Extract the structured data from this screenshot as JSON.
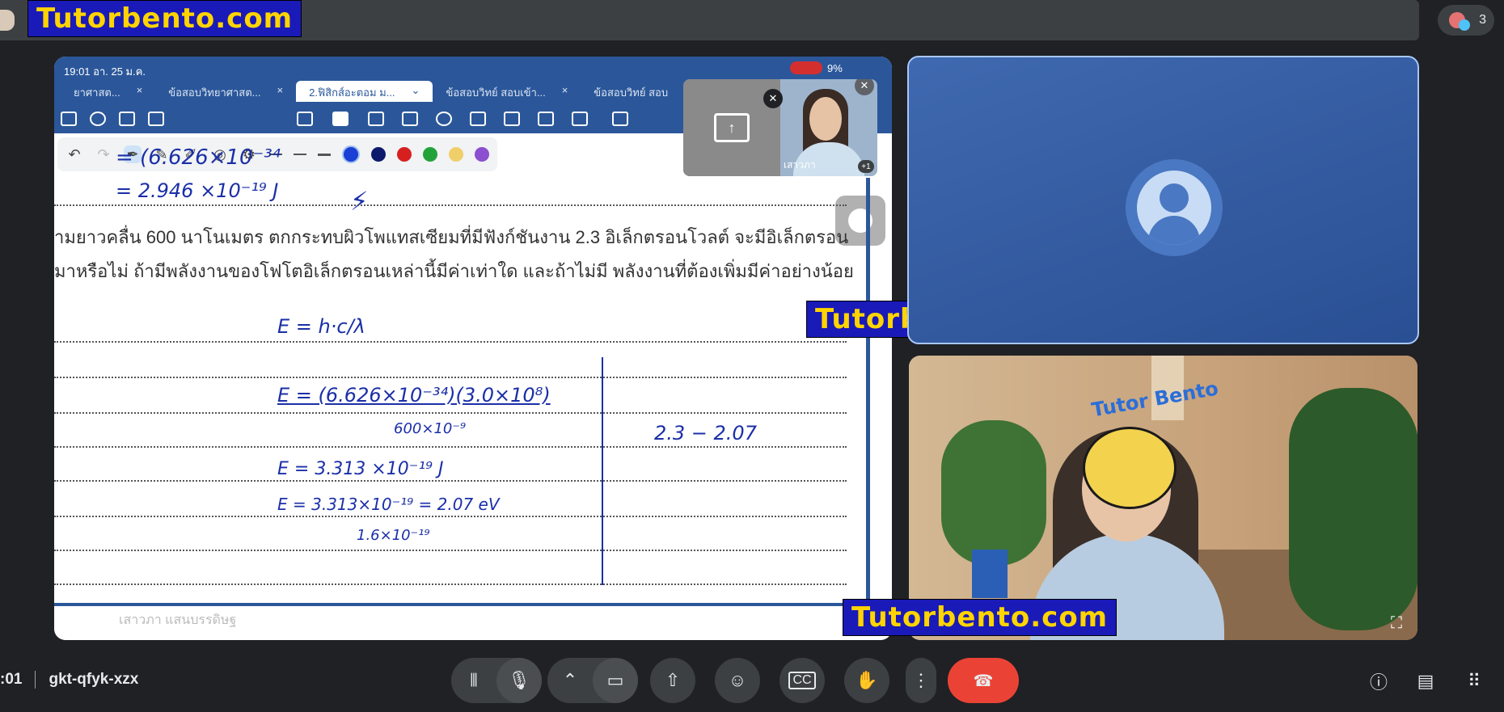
{
  "watermarks": {
    "top": "Tutorbento.com",
    "middle": "Tutorbento.com",
    "bottom": "Tutorbento.com"
  },
  "participants": {
    "count": "3"
  },
  "ipad": {
    "time": "19:01  อา. 25 ม.ค.",
    "battery": "9%",
    "tabs": [
      {
        "label": "ยาศาสต...",
        "close": "×"
      },
      {
        "label": "ข้อสอบวิทยาศาสต...",
        "close": "×"
      },
      {
        "label": "2.ฟิสิกส์อะตอม ม...",
        "close": "⌄"
      },
      {
        "label": "ข้อสอบวิทย์ สอบเข้า...",
        "close": "×"
      },
      {
        "label": "ข้อสอบวิทย์ สอบ",
        "close": ""
      }
    ],
    "pip_name": "เสาวภา",
    "pip_more": "+1",
    "signer": "เสาวภา แสนบรรดิษฐ"
  },
  "note": {
    "line1": "ามยาวคลื่น 600 นาโนเมตร ตกกระทบผิวโพแทสเซียมที่มีฟังก์ชันงาน 2.3 อิเล็กตรอนโวลต์ จะมีอิเล็กตรอน",
    "line2": "มาหรือไม่ ถ้ามีพลังงานของโฟโตอิเล็กตรอนเหล่านี้มีค่าเท่าใด และถ้าไม่มี พลังงานที่ต้องเพิ่มมีค่าอย่างน้อย",
    "hw_top1": "= (6.626×10⁻³⁴",
    "hw_top2": "= 2.946 ×10⁻¹⁹      J",
    "hw_e1": "E = h·c/λ",
    "hw_e2": "E = (6.626×10⁻³⁴)(3.0×10⁸)",
    "hw_e2_den": "600×10⁻⁹",
    "hw_e3": "E  =  3.313 ×10⁻¹⁹   J",
    "hw_e4": "E  =  3.313×10⁻¹⁹  = 2.07 eV",
    "hw_e4_den": "1.6×10⁻¹⁹",
    "hw_side": "2.3 − 2.07"
  },
  "meeting": {
    "time": ":01",
    "code": "gkt-qfyk-xzx"
  },
  "controls": {
    "reactions_icon": "emoji-icon",
    "raise_hand_icon": "hand-icon"
  },
  "colors": {
    "accent": "#2b579a",
    "end_call": "#ea4335",
    "watermark_bg": "#1a1ab8",
    "watermark_text": "#ffd400"
  }
}
